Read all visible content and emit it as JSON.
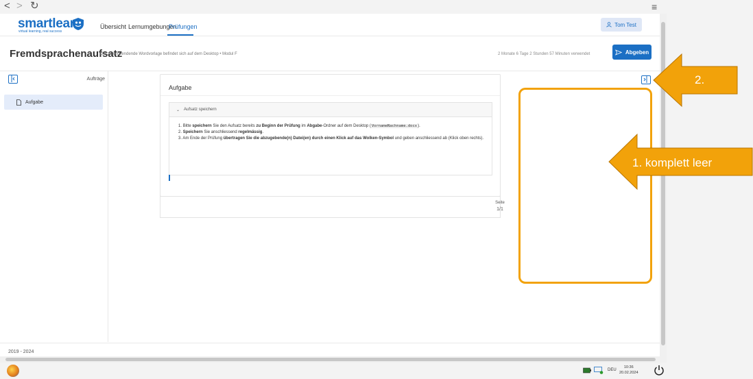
{
  "kiosk": {
    "back": "<",
    "forward": ">",
    "reload": "↻",
    "menu": "≡"
  },
  "header": {
    "logo_text": "smartlearn",
    "logo_sub": "virtual learning, real success",
    "nav": [
      {
        "label": "Übersicht"
      },
      {
        "label": "Lernumgebungen"
      },
      {
        "label": "Prüfungen",
        "active": true
      }
    ],
    "user": "Tom Test"
  },
  "title_row": {
    "title": "Fremdsprachenaufsatz",
    "subtitle": "Die zu verwendende Wordvorlage befindet sich auf dem Desktop • Modul F",
    "time_used": "2 Monate 6 Tage 2 Stunden 57 Minuten verwendet",
    "submit_label": "Abgeben"
  },
  "sidebar": {
    "title": "Aufträge",
    "items": [
      {
        "label": "Aufgabe"
      }
    ],
    "footer": "2019 - 2024"
  },
  "task": {
    "title": "Aufgabe",
    "accordion_title": "Aufsatz speichern",
    "steps": [
      {
        "num": "1.",
        "p1": "Bitte ",
        "b1": "speichern",
        "p2": " Sie den Aufsatz bereits ",
        "b2": "zu Beginn der Prüfung",
        "p3": " im ",
        "b3": "Abgabe",
        "p4": "-Ordner auf dem Desktop (",
        "code": "VornameNachname.docx",
        "p5": ")."
      },
      {
        "num": "2.",
        "b1": "Speichern",
        "p2": " Sie anschliessend ",
        "b2": "regelmässig",
        "p3": "."
      },
      {
        "num": "3.",
        "p1": "Am Ende der Prüfung ",
        "b1": "übertragen Sie die abzugebende(n) Datei(en) durch einen Klick auf das Wolken-Symbol",
        "p2": " und geben anschliessend ab (Klick oben rechts)."
      }
    ]
  },
  "pagination": {
    "label": "Seite",
    "value": "1/1"
  },
  "taskbar": {
    "lang": "DEU",
    "time": "10:36",
    "date": "20.02.2024"
  },
  "annotations": {
    "label_1": "1. komplett leer",
    "label_2": "2.",
    "color": "#f2a20a"
  },
  "colors": {
    "accent": "#1b6fc4",
    "annotation": "#f2a20a"
  }
}
